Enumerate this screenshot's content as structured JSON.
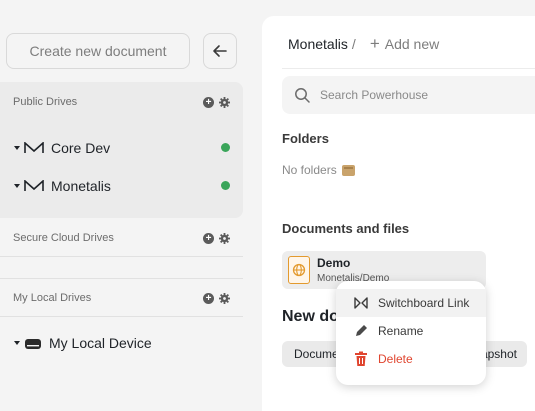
{
  "sidebar": {
    "create_placeholder": "Create new document",
    "sections": {
      "public": {
        "label": "Public Drives"
      },
      "secure": {
        "label": "Secure Cloud Drives"
      },
      "local": {
        "label": "My Local Drives"
      }
    },
    "drives": {
      "core_dev": "Core Dev",
      "monetalis": "Monetalis",
      "local_device": "My Local Device"
    }
  },
  "main": {
    "breadcrumb": {
      "root": "Monetalis",
      "separator": "/",
      "add_new": "Add new"
    },
    "search": {
      "placeholder": "Search Powerhouse"
    },
    "folders": {
      "title": "Folders",
      "empty": "No folders"
    },
    "documents": {
      "title": "Documents and files",
      "items": [
        {
          "name": "Demo",
          "path": "Monetalis/Demo"
        }
      ]
    },
    "new_document": {
      "title": "New document",
      "buttons": [
        "Document",
        "Snapshot"
      ]
    }
  },
  "context_menu": {
    "items": [
      {
        "label": "Switchboard Link",
        "icon": "switchboard-icon"
      },
      {
        "label": "Rename",
        "icon": "pencil-icon"
      },
      {
        "label": "Delete",
        "icon": "trash-icon"
      }
    ]
  },
  "colors": {
    "status_green": "#3aa55a",
    "danger": "#e0452f",
    "file_orange": "#e39a2e"
  }
}
